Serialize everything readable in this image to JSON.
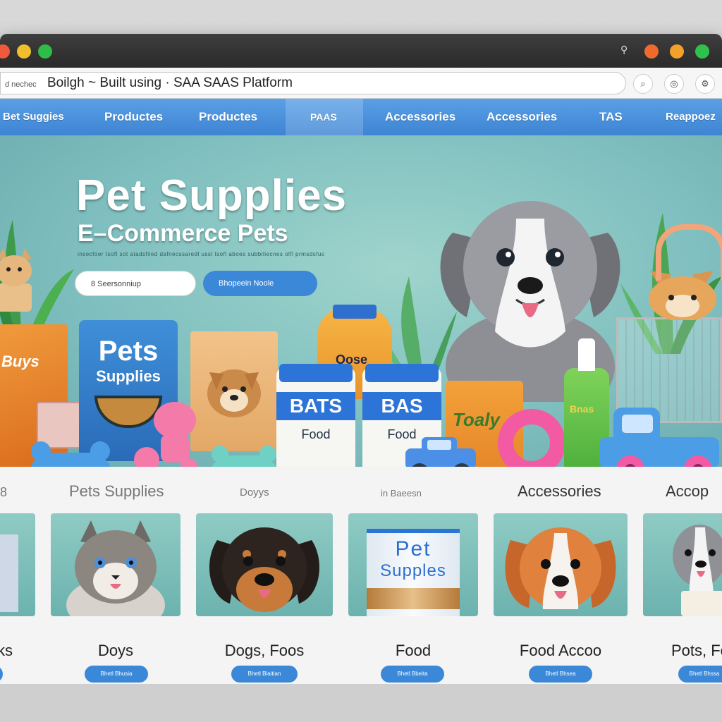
{
  "browser": {
    "traffic_lights": [
      "#f05a3c",
      "#f0c02c",
      "#2ebd47"
    ],
    "right_lights": [
      "#f26a2b",
      "#f3a12a",
      "#2ec24a"
    ],
    "url_prefix": "d nechec",
    "url_text": "Boilgh ~ Built using · SAA SAAS Platform"
  },
  "nav": {
    "items": [
      "Bet Suggies",
      "Productes",
      "Productes",
      "PAAS",
      "Accessories",
      "Accessories",
      "TAS",
      "Reappoez"
    ]
  },
  "hero": {
    "title": "Pet Supplies",
    "subtitle": "E–Commerce Pets",
    "fine_print": "insecfoer tsofl sot atadsfiled dafnecssaredl ussl tsofl aboes subbiliecnes olfl prmsdsfus",
    "btn_white": "8 Seersonniup",
    "btn_blue": "Bhopeein Noole",
    "products": {
      "box_pets_line1": "Pets",
      "box_pets_line2": "Supplies",
      "box_left_label": "Buys",
      "jar1_line1": "BATS",
      "jar1_line2": "Food",
      "jar2_line1": "BAS",
      "jar2_line2": "Food",
      "can_label": "Toaly",
      "bottle_label": "Bnas",
      "honey_label": "Oose"
    }
  },
  "categories": {
    "labels": [
      "8",
      "Pets Supplies",
      "Doyys",
      "in Baeesn",
      "Accessories",
      "Accop"
    ]
  },
  "cards": [
    {
      "title": "ks",
      "button": ""
    },
    {
      "title": "Doys",
      "button": "Bhetl Bhusia"
    },
    {
      "title": "Dogs, Foos",
      "button": "Bhetl Blaitian"
    },
    {
      "title": "Food",
      "button": "Bhetl Bbeita"
    },
    {
      "title": "Food Accoo",
      "button": "Bhetl Bhsea"
    },
    {
      "title": "Pots, Fo",
      "button": "Bhetl Bhssa"
    }
  ],
  "can_card": {
    "line1": "Pet",
    "line2": "Supples"
  },
  "colors": {
    "nav_blue": "#3d84d3",
    "hero_teal": "#7fbfbf",
    "button_blue": "#3b88d8",
    "shelf_wood": "#c99e6a"
  }
}
